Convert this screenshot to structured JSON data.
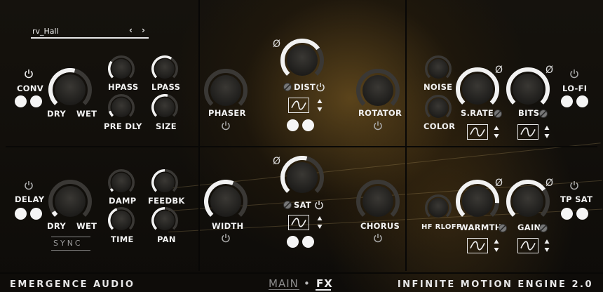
{
  "preset": {
    "name": "rv_Hall",
    "prev": "‹",
    "next": "›"
  },
  "reverb": {
    "conv_label": "CONV",
    "dry_label": "DRY",
    "wet_label": "WET",
    "hpass_label": "HPASS",
    "lpass_label": "LPASS",
    "predly_label": "PRE DLY",
    "size_label": "SIZE"
  },
  "delay": {
    "delay_label": "DELAY",
    "dry_label": "DRY",
    "wet_label": "WET",
    "sync_label": "SYNC",
    "damp_label": "DAMP",
    "feedbk_label": "FEEDBK",
    "time_label": "TIME",
    "pan_label": "PAN"
  },
  "middle": {
    "phaser_label": "PHASER",
    "dist_label": "DIST",
    "rotator_label": "ROTATOR",
    "width_label": "WIDTH",
    "sat_label": "SAT",
    "chorus_label": "CHORUS",
    "phase_symbol": "Ø"
  },
  "right": {
    "noise_label": "NOISE",
    "color_label": "COLOR",
    "srate_label": "S.RATE",
    "bits_label": "BITS",
    "lofi_label": "LO-FI",
    "hfrloff_label": "HF RLOFF",
    "warmth_label": "WARMTH",
    "gain_label": "GAIN",
    "tpsat_label": "TP SAT",
    "phase_symbol": "Ø"
  },
  "footer": {
    "brand": "EMERGENCE AUDIO",
    "tab_main": "MAIN",
    "tab_sep": "•",
    "tab_fx": "FX",
    "product": "INFINITE MOTION ENGINE 2.0"
  },
  "knob_values": {
    "rev_drywet": 0.55,
    "hpass": 0.3,
    "lpass": 0.62,
    "predly": 0.1,
    "size": 0.55,
    "del_drywet": 0.05,
    "damp": 0.05,
    "feedbk": 0.5,
    "time": 0.42,
    "pan": 0.5,
    "phaser": 0.0,
    "dist": 0.7,
    "rotator": 0.0,
    "width": 0.58,
    "sat": 0.55,
    "chorus": 0.0,
    "noise": 0.0,
    "color": 0.0,
    "srate": 1.0,
    "bits": 1.0,
    "hfrloff": 0.0,
    "warmth": 0.85,
    "gain": 0.7
  },
  "colors": {
    "accent": "#f2f2f2",
    "track": "#3a3835",
    "background": "#0e0c09"
  }
}
